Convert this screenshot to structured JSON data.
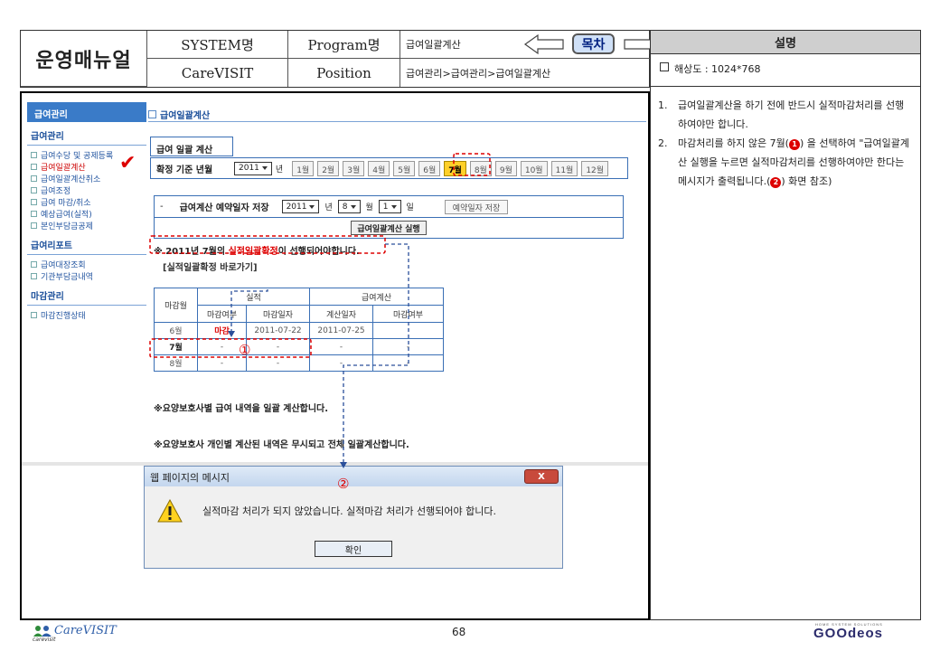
{
  "header": {
    "manual_title": "운영매뉴얼",
    "system_label": "SYSTEM명",
    "system_value": "CareVISIT",
    "program_label": "Program명",
    "program_value": "급여일괄계산",
    "position_label": "Position",
    "position_value": "급여관리>급여관리>급여일괄계산",
    "toc_label": "목차"
  },
  "description": {
    "title": "설명",
    "resolution": "해상도 : 1024*768",
    "items": [
      {
        "num": "1.",
        "text": "급여일괄계산을 하기 전에 반드시 실적마감처리를 선행하여야만 합니다."
      },
      {
        "num": "2.",
        "text_a": "마감처리를 하지 않은 7월(",
        "text_b": ") 을 선택하여 \"급여일괄계산 실행을 누르면 실적마감처리를 선행하여야만 한다는 메시지가 출력됩니다.(",
        "text_c": ") 화면 참조)"
      }
    ],
    "circle1": "1",
    "circle2": "2"
  },
  "sidebar": {
    "header": "급여관리",
    "section1": "급여관리",
    "items1": [
      "급여수당 및 공제등록",
      "급여일괄계산",
      "급여일괄계산취소",
      "급여조정",
      "급여 마감/취소",
      "예상급여(실적)",
      "본인부담금공제"
    ],
    "section2": "급여리포트",
    "items2": [
      "급여대장조회",
      "기관부담금내역"
    ],
    "section3": "마감관리",
    "items3": [
      "마감진행상태"
    ],
    "active_index": 1
  },
  "content": {
    "page_title": "급여일괄계산",
    "table_header": "급여 일괄 계산",
    "base_month_label": "확정 기준 년월",
    "year_value": "2011",
    "year_unit": "년",
    "months": [
      "1월",
      "2월",
      "3월",
      "4월",
      "5월",
      "6월",
      "7월",
      "8월",
      "9월",
      "10월",
      "11월",
      "12월"
    ],
    "selected_month_index": 6,
    "reserve_dash": "-",
    "reserve_label": "급여계산 예약일자 저장",
    "reserve_year": "2011",
    "reserve_month": "8",
    "reserve_day": "1",
    "year_unit2": "년",
    "month_unit": "월",
    "day_unit": "일",
    "save_button": "예약일자 저장",
    "run_button": "급여일괄계산 실행",
    "notice_a": "※ 2011년 7월의 ",
    "notice_b": "실적일괄확정",
    "notice_c": "이 선행되어야합니다.",
    "shortcut": "[실적일괄확정 바로가기]",
    "grid": {
      "col_month": "마감월",
      "group_actual": "실적",
      "group_payroll": "급여계산",
      "sub_headers": [
        "마감여부",
        "마감일자",
        "계산일자",
        "마감여부"
      ],
      "rows": [
        [
          "6월",
          "마감",
          "2011-07-22",
          "2011-07-25",
          ""
        ],
        [
          "7월",
          "-",
          "-",
          "-",
          "-"
        ],
        [
          "8월",
          "-",
          "-",
          "-",
          "-"
        ]
      ]
    },
    "note1": "※요양보호사별 급여 내역을 일괄 계산합니다.",
    "note2": "※요양보호사 개인별 계산된 내역은 무시되고 전체 일괄계산합니다."
  },
  "dialog": {
    "title": "웹 페이지의 메시지",
    "close": "X",
    "message": "실적마감 처리가 되지 않았습니다. 실적마감 처리가 선행되어야 합니다.",
    "ok": "확인"
  },
  "annotations": {
    "marker1": "①",
    "marker2": "②"
  },
  "footer": {
    "logo": "CareVISIT",
    "logo_sub": "carevisit",
    "page": "68",
    "brand": "GOOdeos",
    "brand_tag": "HOME SYSTEM SOLUTIONS"
  },
  "colors": {
    "accent_blue": "#3a7bc8",
    "annotation_red": "#d00000",
    "selected_month": "#ffd02a"
  }
}
